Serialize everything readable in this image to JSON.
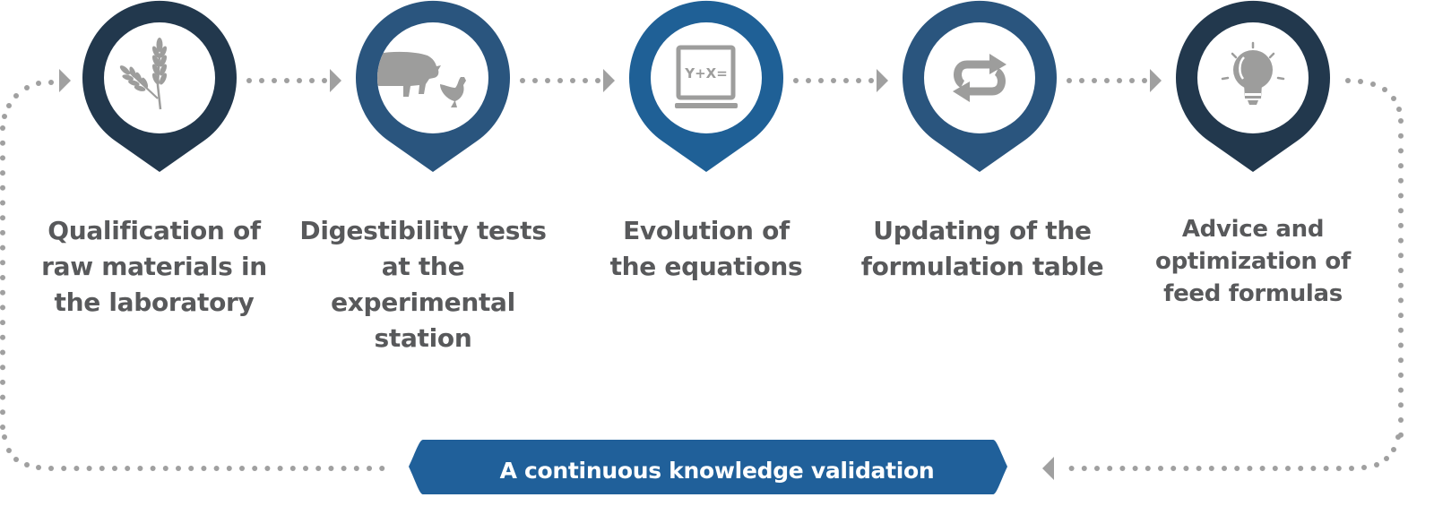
{
  "colors": {
    "pin_dark": "#22384d",
    "pin_mid": "#2a557e",
    "pin_bright": "#1f6096",
    "icon_gray": "#9d9d9c",
    "dot_gray": "#a0a0a0",
    "label_gray": "#58595b",
    "banner_blue": "#20609a",
    "banner_text": "#ffffff"
  },
  "steps": [
    {
      "icon": "wheat-icon",
      "color_key": "pin_dark",
      "lines": [
        "Qualification of",
        "raw materials in",
        "the laboratory"
      ]
    },
    {
      "icon": "pig-chicken-icon",
      "color_key": "pin_mid",
      "lines": [
        "Digestibility tests",
        "at the experimental",
        "station"
      ]
    },
    {
      "icon": "laptop-equation-icon",
      "color_key": "pin_bright",
      "icon_text": "Y+X=",
      "lines": [
        "Evolution of",
        "the equations"
      ]
    },
    {
      "icon": "refresh-arrows-icon",
      "color_key": "pin_mid",
      "lines": [
        "Updating of the",
        "formulation table"
      ]
    },
    {
      "icon": "lightbulb-icon",
      "color_key": "pin_dark",
      "lines": [
        "Advice and",
        "optimization of",
        "feed formulas"
      ]
    }
  ],
  "banner": {
    "label": "A continuous knowledge validation"
  }
}
